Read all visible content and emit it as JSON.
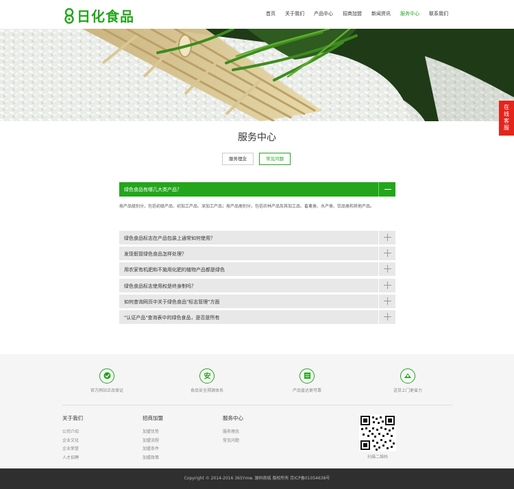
{
  "brand": {
    "name": "日化食品",
    "color": "#23a61b"
  },
  "nav": {
    "items": [
      {
        "label": "首页"
      },
      {
        "label": "关于我们"
      },
      {
        "label": "产品中心"
      },
      {
        "label": "招商加盟"
      },
      {
        "label": "新闻资讯"
      },
      {
        "label": "服务中心"
      },
      {
        "label": "联系我们"
      }
    ],
    "active_index": 5
  },
  "chat": {
    "label_1": "在",
    "label_2": "线",
    "label_3": "客",
    "label_4": "服"
  },
  "page": {
    "title": "服务中心",
    "tabs": [
      {
        "label": "服务理念"
      },
      {
        "label": "常见问题"
      }
    ],
    "active_tab": 1
  },
  "faq": {
    "open": {
      "question": "绿色食品有哪几大类产品？",
      "answer": "按产品级别分，包括初级产品、初加工产品、深加工产品；按产品类别分，包括农林产品及其加工品、畜禽类、水产类、饮品类和其他产品。"
    },
    "items": [
      {
        "question": "绿色食品标志在产品包装上通常如何使用？"
      },
      {
        "question": "发现假冒绿色食品怎样处理？"
      },
      {
        "question": "用农家有机肥和不施用化肥的植物产品都是绿色"
      },
      {
        "question": "绿色食品标志使用权是终身制吗？"
      },
      {
        "question": "如何查询网页中关于绿色食品\"标志管理\"方面"
      },
      {
        "question": "\"认证产品\"查询表中的绿色食品，是否是所有"
      }
    ]
  },
  "features": [
    {
      "label": "官方网站正品保证",
      "icon": "official-icon"
    },
    {
      "label": "食品安全溯源体系",
      "icon": "safe-icon"
    },
    {
      "label": "产品直达更可靠",
      "icon": "delivery-icon"
    },
    {
      "label": "送货上门更省力",
      "icon": "door-icon"
    }
  ],
  "footer_cols": [
    {
      "title": "关于我们",
      "links": [
        "公司介绍",
        "企业文化",
        "企业荣誉",
        "人才招聘"
      ]
    },
    {
      "title": "招商加盟",
      "links": [
        "加盟优势",
        "加盟流程",
        "加盟条件",
        "加盟政策"
      ]
    },
    {
      "title": "服务中心",
      "links": [
        "服务理念",
        "常见问题"
      ]
    }
  ],
  "qr": {
    "label": "扫描二维码"
  },
  "copyright": "Copyright © 2014-2016 365Ymw. 源码商城 版权所有   京ICP备01054638号"
}
